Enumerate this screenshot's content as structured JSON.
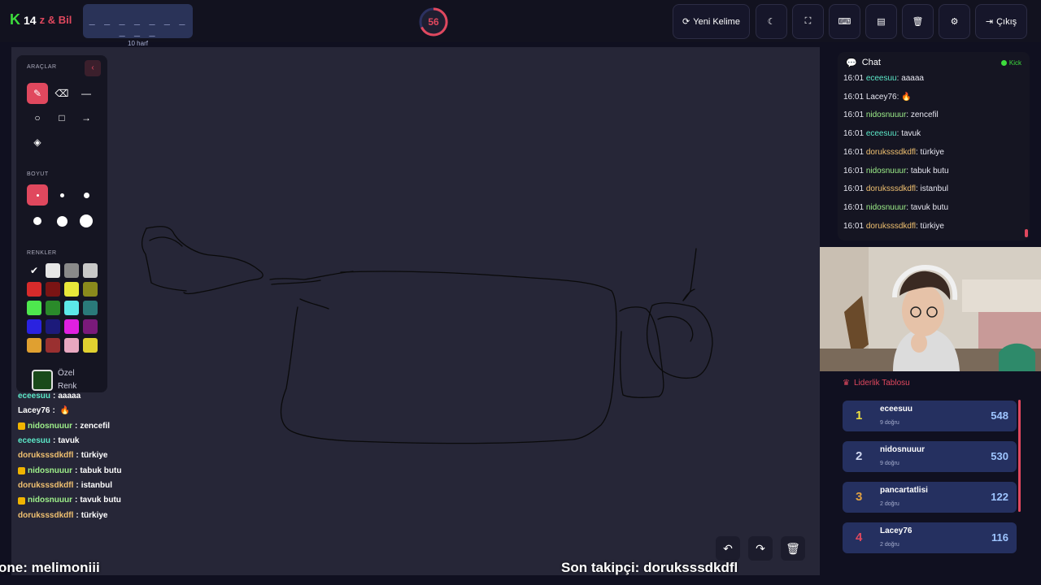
{
  "header": {
    "logo_k": "K",
    "logo_num": "14",
    "logo_title": "z & Bil",
    "word_dashes": "_ _ _ _ _ _ _ _ _ _",
    "word_hint": "10 harf",
    "timer": "56",
    "buttons": {
      "new_word": "Yeni Kelime",
      "exit": "Çıkış"
    }
  },
  "tools": {
    "section_tools": "ARAÇLAR",
    "section_size": "BOYUT",
    "section_colors": "RENKLER",
    "custom_color": "Özel",
    "custom_color_2": "Renk",
    "colors": [
      "#ffffff",
      "#e6e6e6",
      "#8a8a8a",
      "#c8c8c8",
      "#d82b2b",
      "#7a1414",
      "#e8e83a",
      "#8a8a1c",
      "#4ee84e",
      "#2a8a2a",
      "#5ce8e8",
      "#2a7a7a",
      "#2a22e0",
      "#1c1a7a",
      "#e020e0",
      "#7a1a7a",
      "#e0a030",
      "#9a3030",
      "#e8a8c0",
      "#e0d030"
    ]
  },
  "canvas_tools": {
    "undo": "↶",
    "redo": "↷",
    "clear": "🗑"
  },
  "overlay_chat": [
    {
      "user": "eceesuu",
      "text": "aaaaa",
      "color": "#5ce8c8"
    },
    {
      "user": "Lacey76",
      "text": "",
      "color": "#ffffff"
    },
    {
      "user": "nidosnuuur",
      "text": "zencefil",
      "color": "#9ef08a"
    },
    {
      "user": "eceesuu",
      "text": "tavuk",
      "color": "#5ce8c8"
    },
    {
      "user": "doruksssdkdfl",
      "text": "türkiye",
      "color": "#f0c070"
    },
    {
      "user": "nidosnuuur",
      "text": "tabuk butu",
      "color": "#9ef08a"
    },
    {
      "user": "doruksssdkdfl",
      "text": "istanbul",
      "color": "#f0c070"
    },
    {
      "user": "nidosnuuur",
      "text": "tavuk butu",
      "color": "#9ef08a"
    },
    {
      "user": "doruksssdkdfl",
      "text": "türkiye",
      "color": "#f0c070"
    }
  ],
  "overlay_bottom_left": "one: melimoniii",
  "overlay_bottom_center": "Son takipçi: doruksssdkdfl",
  "chat": {
    "title": "Chat",
    "platform": "Kick",
    "messages": [
      {
        "time": "16:01",
        "user": "eceesuu",
        "text": "aaaaa",
        "color": "#5ce8c8"
      },
      {
        "time": "16:01",
        "user": "Lacey76",
        "text": "",
        "color": "#e6e6f0"
      },
      {
        "time": "16:01",
        "user": "nidosnuuur",
        "text": "zencefil",
        "color": "#9ef08a"
      },
      {
        "time": "16:01",
        "user": "eceesuu",
        "text": "tavuk",
        "color": "#5ce8c8"
      },
      {
        "time": "16:01",
        "user": "doruksssdkdfl",
        "text": "türkiye",
        "color": "#f0c070"
      },
      {
        "time": "16:01",
        "user": "nidosnuuur",
        "text": "tabuk butu",
        "color": "#9ef08a"
      },
      {
        "time": "16:01",
        "user": "doruksssdkdfl",
        "text": "istanbul",
        "color": "#f0c070"
      },
      {
        "time": "16:01",
        "user": "nidosnuuur",
        "text": "tavuk butu",
        "color": "#9ef08a"
      },
      {
        "time": "16:01",
        "user": "doruksssdkdfl",
        "text": "türkiye",
        "color": "#f0c070"
      }
    ]
  },
  "leaderboard": {
    "title": "Liderlik Tablosu",
    "rows": [
      {
        "rank": "1",
        "name": "eceesuu",
        "sub": "9 doğru",
        "score": "548",
        "color": "#f0e040"
      },
      {
        "rank": "2",
        "name": "nidosnuuur",
        "sub": "9 doğru",
        "score": "530",
        "color": "#d0d8f0"
      },
      {
        "rank": "3",
        "name": "pancartatlisi",
        "sub": "2 doğru",
        "score": "122",
        "color": "#e0a040"
      },
      {
        "rank": "4",
        "name": "Lacey76",
        "sub": "2 doğru",
        "score": "116",
        "color": "#e0485e"
      }
    ]
  },
  "colors": {
    "accent": "#e0485e",
    "panel": "#151522",
    "canvas": "#262637"
  }
}
